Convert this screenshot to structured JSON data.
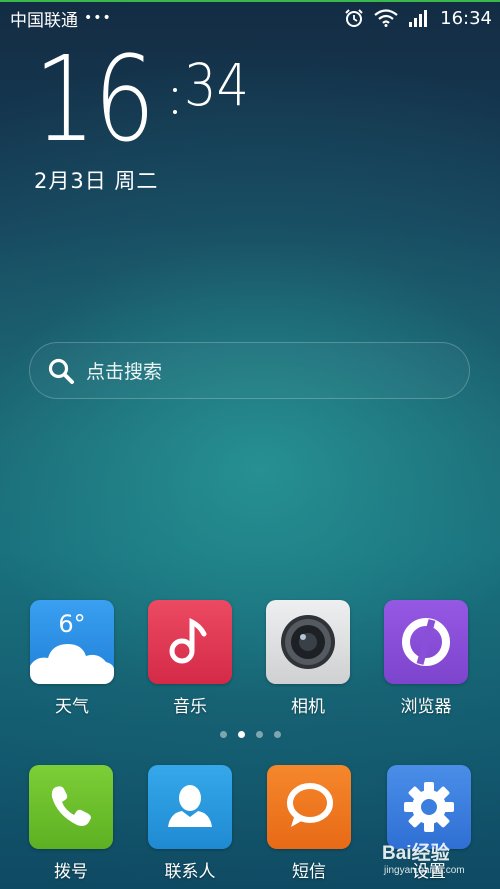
{
  "status_bar": {
    "carrier": "中国联通",
    "dots": "•••",
    "time": "16:34",
    "icons": [
      "alarm-icon",
      "wifi-icon",
      "signal-icon"
    ]
  },
  "clock": {
    "hour": "16",
    "minute": "34",
    "date": "2月3日 周二"
  },
  "search": {
    "placeholder": "点击搜索",
    "icon": "search-icon"
  },
  "apps_row": [
    {
      "label": "天气",
      "icon": "weather-icon",
      "badge": "6°",
      "color": "#2b8fe6"
    },
    {
      "label": "音乐",
      "icon": "music-icon",
      "color": "#e23a55"
    },
    {
      "label": "相机",
      "icon": "camera-icon",
      "color": "#d9dadc"
    },
    {
      "label": "浏览器",
      "icon": "browser-icon",
      "color": "#8a4fd8"
    }
  ],
  "page_indicator": {
    "count": 4,
    "active": 1
  },
  "dock": [
    {
      "label": "拨号",
      "icon": "phone-icon",
      "color": "#6cc02c"
    },
    {
      "label": "联系人",
      "icon": "contacts-icon",
      "color": "#2a9be0"
    },
    {
      "label": "短信",
      "icon": "message-icon",
      "color": "#f07a22"
    },
    {
      "label": "设置",
      "icon": "settings-icon",
      "color": "#3a7ee0"
    }
  ],
  "watermark": {
    "logo": "Bai经验",
    "url": "jingyan.baidu.com"
  }
}
